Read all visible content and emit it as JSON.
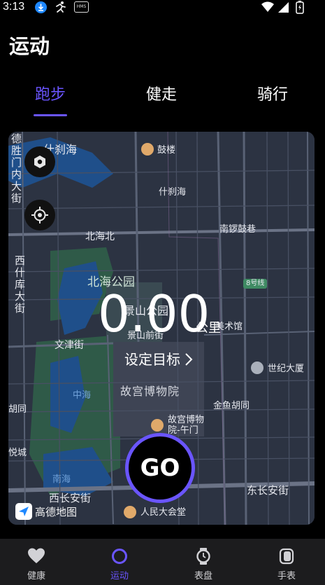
{
  "status_bar": {
    "time": "3:13",
    "hms_badge": "HMS"
  },
  "page_title": "运动",
  "tabs": [
    {
      "label": "跑步",
      "active": true
    },
    {
      "label": "健走",
      "active": false
    },
    {
      "label": "骑行",
      "active": false
    }
  ],
  "map": {
    "labels": {
      "shichahai": "什刹海",
      "gulou": "鼓楼",
      "shichahai2": "什刹海",
      "dexingmen": "德胜门内大街",
      "beihaibei": "北海北",
      "nanluoguxiang": "南锣鼓巷",
      "line8": "8号线",
      "beihaipark": "北海公园",
      "xishikudajie": "西什库大街",
      "jingshanpark": "景山公园",
      "jingshanqianjie": "景山前街",
      "meishuguan": "美术馆",
      "wenjinjie": "文津街",
      "shijidasha": "世纪大厦",
      "zhonghai": "中海",
      "gugong": "故宫博物院",
      "jinyuhutong": "金鱼胡同",
      "gugongwumen": "故宫博物院-午门",
      "hutong": "胡同",
      "yuecheng": "悦城",
      "nanhai": "南海",
      "changanxi": "西长安街",
      "changandong": "东长安街",
      "renmindahuitang": "人民大会堂"
    },
    "logo_text": "高德地图"
  },
  "distance": {
    "value": "0.00",
    "unit": "公里"
  },
  "goal_label": "设定目标",
  "go_label": "GO",
  "bottom_nav": [
    {
      "label": "健康",
      "icon": "heart-icon",
      "active": false
    },
    {
      "label": "运动",
      "icon": "circle-icon",
      "active": true
    },
    {
      "label": "表盘",
      "icon": "watch-face-icon",
      "active": false
    },
    {
      "label": "手表",
      "icon": "watch-icon",
      "active": false
    }
  ],
  "colors": {
    "accent": "#6a55ff",
    "map_bg": "#2c3342",
    "park": "#2f5a48",
    "water": "#1f4f8a",
    "road": "#596275"
  }
}
